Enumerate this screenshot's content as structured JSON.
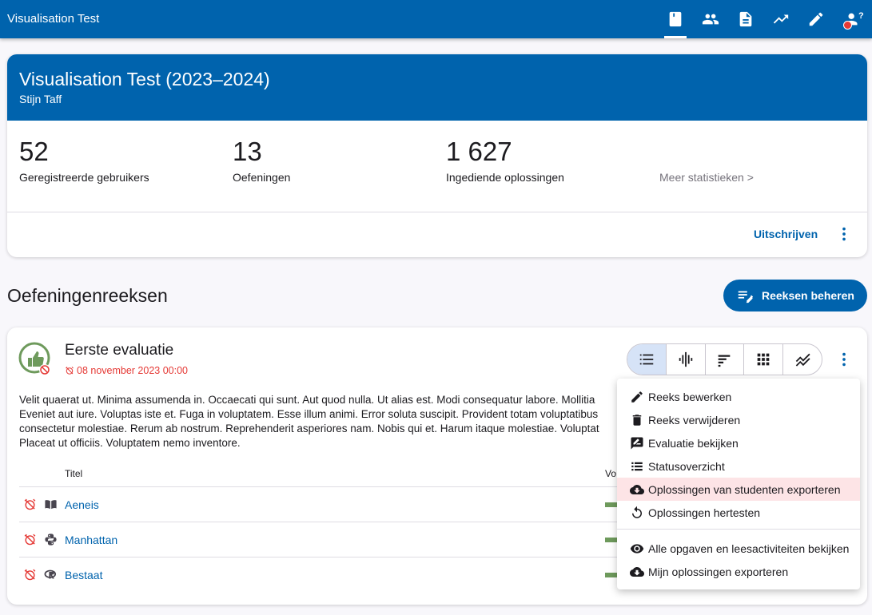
{
  "app": {
    "title": "Visualisation Test"
  },
  "nav": {
    "icons": [
      "book-icon",
      "people-icon",
      "document-icon",
      "trending-up-icon",
      "pencil-icon",
      "user-question-icon"
    ],
    "user_badge": "?"
  },
  "course": {
    "title": "Visualisation Test (2023–2024)",
    "teacher": "Stijn Taff",
    "stats": [
      {
        "value": "52",
        "label": "Geregistreerde gebruikers"
      },
      {
        "value": "13",
        "label": "Oefeningen"
      },
      {
        "value": "1 627",
        "label": "Ingediende oplossingen"
      }
    ],
    "more_stats": "Meer statistieken >",
    "unsubscribe": "Uitschrijven"
  },
  "series_section": {
    "title": "Oefeningenreeksen",
    "manage_button": "Reeksen beheren"
  },
  "series": {
    "title": "Eerste evaluatie",
    "deadline": "08 november 2023 00:00",
    "description": "Velit quaerat ut. Minima assumenda in. Occaecati qui sunt. Aut quod nulla. Ut alias est. Modi consequatur labore. Mollitia\nEveniet aut iure. Voluptas iste et. Fuga in voluptatem. Esse illum animi. Error soluta suscipit. Provident totam voluptatibus\nconsectetur molestiae. Rerum ab nostrum. Reprehenderit asperiores nam. Nobis qui et. Harum itaque molestiae. Voluptat\nPlaceat ut officiis. Voluptatem nemo inventore.",
    "table_header_title": "Titel",
    "table_header_progress": "Vo",
    "exercises": [
      {
        "name": "Aeneis",
        "type_icon": "book-open-icon",
        "progress": 0.35
      },
      {
        "name": "Manhattan",
        "type_icon": "python-icon",
        "progress": 0.35
      },
      {
        "name": "Bestaat",
        "type_icon": "r-language-icon",
        "progress": 0.35
      }
    ]
  },
  "menu": {
    "items": [
      {
        "label": "Reeks bewerken",
        "icon": "pencil-icon"
      },
      {
        "label": "Reeks verwijderen",
        "icon": "trash-icon"
      },
      {
        "label": "Evaluatie bekijken",
        "icon": "evaluation-icon"
      },
      {
        "label": "Statusoverzicht",
        "icon": "list-icon"
      },
      {
        "label": "Oplossingen van studenten exporteren",
        "icon": "cloud-download-icon",
        "highlighted": true
      },
      {
        "label": "Oplossingen hertesten",
        "icon": "refresh-icon"
      },
      {
        "label": "Alle opgaven en leesactiviteiten bekijken",
        "icon": "eye-icon"
      },
      {
        "label": "Mijn oplossingen exporteren",
        "icon": "cloud-download-icon"
      }
    ]
  },
  "colors": {
    "primary": "#0063ad",
    "deadline": "#e53935",
    "progress": "#6e9a5c",
    "highlight": "#fde4e6"
  }
}
